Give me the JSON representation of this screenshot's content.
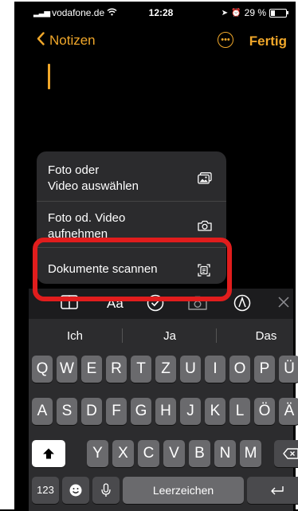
{
  "status": {
    "carrier": "vodafone.de",
    "time": "12:28",
    "battery_percent_text": "29 %",
    "battery_level": 0.29,
    "icons": [
      "signal-icon",
      "wifi-icon",
      "location-icon",
      "alarm-icon",
      "battery-icon"
    ]
  },
  "nav": {
    "back_label": "Notizen",
    "done_label": "Fertig",
    "more_icon": "ellipsis-circle-icon"
  },
  "menu": {
    "items": [
      {
        "label": "Foto oder Video auswählen",
        "line1": "Foto oder",
        "line2": "Video auswählen",
        "icon": "photo-library-icon"
      },
      {
        "label": "Foto od. Video aufnehmen",
        "line1": "Foto od. Video",
        "line2": "aufnehmen",
        "icon": "camera-icon"
      },
      {
        "label": "Dokumente scannen",
        "icon": "document-scan-icon"
      }
    ]
  },
  "toolbar": {
    "items": [
      "table-icon",
      "Aa",
      "checklist-icon",
      "camera-icon",
      "markup-icon",
      "close-icon"
    ],
    "aa_label": "Aa"
  },
  "suggestions": [
    "Ich",
    "Ja",
    "Das"
  ],
  "keyboard": {
    "row1": [
      "Q",
      "W",
      "E",
      "R",
      "T",
      "Z",
      "U",
      "I",
      "O",
      "P",
      "Ü"
    ],
    "row2": [
      "A",
      "S",
      "D",
      "F",
      "G",
      "H",
      "J",
      "K",
      "L",
      "Ö",
      "Ä"
    ],
    "row3": [
      "Y",
      "X",
      "C",
      "V",
      "B",
      "N",
      "M"
    ],
    "numbers_label": "123",
    "space_label": "Leerzeichen"
  },
  "colors": {
    "accent": "#f0a72a",
    "highlight": "#e11d1d"
  }
}
